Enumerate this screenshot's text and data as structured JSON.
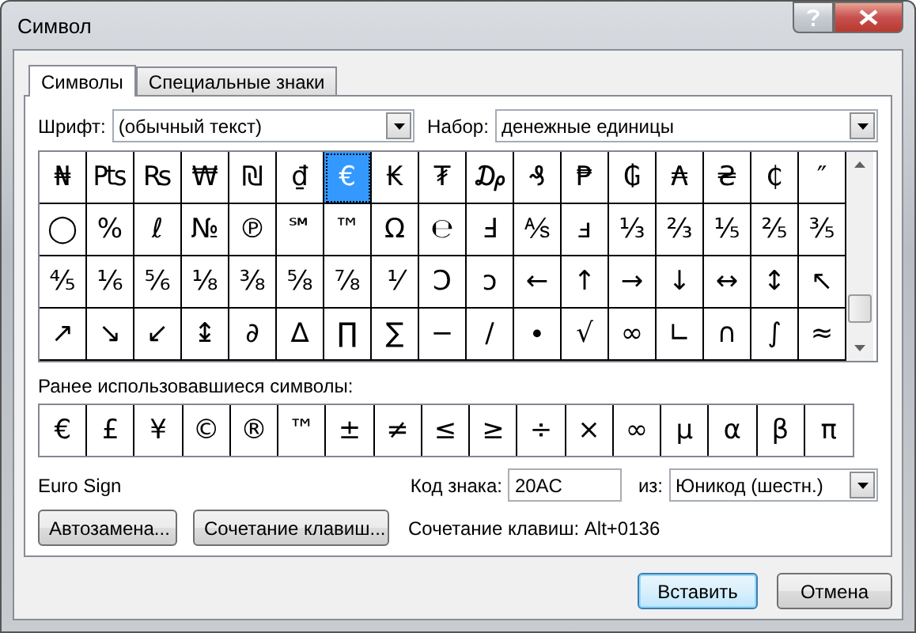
{
  "window": {
    "title": "Символ"
  },
  "tabs": [
    {
      "label": "Символы",
      "selected": true
    },
    {
      "label": "Специальные знаки",
      "selected": false
    }
  ],
  "font": {
    "label": "Шрифт:",
    "value": "(обычный текст)"
  },
  "subset": {
    "label": "Набор:",
    "value": "денежные единицы"
  },
  "symbols": [
    [
      {
        "char": "₦",
        "selected": false
      },
      {
        "char": "₧",
        "selected": false
      },
      {
        "char": "₨",
        "selected": false
      },
      {
        "char": "₩",
        "selected": false
      },
      {
        "char": "₪",
        "selected": false
      },
      {
        "char": "₫",
        "selected": false
      },
      {
        "char": "€",
        "selected": true
      },
      {
        "char": "₭",
        "selected": false
      },
      {
        "char": "₮",
        "selected": false
      },
      {
        "char": "₯",
        "selected": false
      },
      {
        "char": "₰",
        "selected": false
      },
      {
        "char": "₱",
        "selected": false
      },
      {
        "char": "₲",
        "selected": false
      },
      {
        "char": "₳",
        "selected": false
      },
      {
        "char": "₴",
        "selected": false
      },
      {
        "char": "₵",
        "selected": false
      },
      {
        "char": "″",
        "selected": false
      }
    ],
    [
      {
        "char": "◯",
        "selected": false
      },
      {
        "char": "%",
        "selected": false
      },
      {
        "char": "ℓ",
        "selected": false
      },
      {
        "char": "№",
        "selected": false
      },
      {
        "char": "℗",
        "selected": false
      },
      {
        "char": "℠",
        "selected": false
      },
      {
        "char": "™",
        "selected": false
      },
      {
        "char": "Ω",
        "selected": false
      },
      {
        "char": "℮",
        "selected": false
      },
      {
        "char": "Ⅎ",
        "selected": false
      },
      {
        "char": "⅍",
        "selected": false
      },
      {
        "char": "ⅎ",
        "selected": false
      },
      {
        "char": "⅓",
        "selected": false
      },
      {
        "char": "⅔",
        "selected": false
      },
      {
        "char": "⅕",
        "selected": false
      },
      {
        "char": "⅖",
        "selected": false
      },
      {
        "char": "⅗",
        "selected": false
      }
    ],
    [
      {
        "char": "⅘",
        "selected": false
      },
      {
        "char": "⅙",
        "selected": false
      },
      {
        "char": "⅚",
        "selected": false
      },
      {
        "char": "⅛",
        "selected": false
      },
      {
        "char": "⅜",
        "selected": false
      },
      {
        "char": "⅝",
        "selected": false
      },
      {
        "char": "⅞",
        "selected": false
      },
      {
        "char": "⅟",
        "selected": false
      },
      {
        "char": "Ↄ",
        "selected": false
      },
      {
        "char": "ↄ",
        "selected": false
      },
      {
        "char": "←",
        "selected": false
      },
      {
        "char": "↑",
        "selected": false
      },
      {
        "char": "→",
        "selected": false
      },
      {
        "char": "↓",
        "selected": false
      },
      {
        "char": "↔",
        "selected": false
      },
      {
        "char": "↕",
        "selected": false
      },
      {
        "char": "↖",
        "selected": false
      }
    ],
    [
      {
        "char": "↗",
        "selected": false
      },
      {
        "char": "↘",
        "selected": false
      },
      {
        "char": "↙",
        "selected": false
      },
      {
        "char": "↨",
        "selected": false
      },
      {
        "char": "∂",
        "selected": false
      },
      {
        "char": "∆",
        "selected": false
      },
      {
        "char": "∏",
        "selected": false
      },
      {
        "char": "∑",
        "selected": false
      },
      {
        "char": "−",
        "selected": false
      },
      {
        "char": "∕",
        "selected": false
      },
      {
        "char": "∙",
        "selected": false
      },
      {
        "char": "√",
        "selected": false
      },
      {
        "char": "∞",
        "selected": false
      },
      {
        "char": "∟",
        "selected": false
      },
      {
        "char": "∩",
        "selected": false
      },
      {
        "char": "∫",
        "selected": false
      },
      {
        "char": "≈",
        "selected": false
      }
    ]
  ],
  "recent_label": "Ранее использовавшиеся символы:",
  "recent": [
    "€",
    "£",
    "¥",
    "©",
    "®",
    "™",
    "±",
    "≠",
    "≤",
    "≥",
    "÷",
    "×",
    "∞",
    "μ",
    "α",
    "β",
    "π"
  ],
  "char_name": "Euro Sign",
  "char_code": {
    "label": "Код знака:",
    "value": "20AC"
  },
  "from": {
    "label": "из:",
    "value": "Юникод (шестн.)"
  },
  "buttons": [
    "Автозамена...",
    "Сочетание клавиш..."
  ],
  "shortcut": "Сочетание клавиш: Alt+0136",
  "dialog_buttons": [
    {
      "label": "Вставить",
      "default": true
    },
    {
      "label": "Отмена",
      "default": false
    }
  ]
}
